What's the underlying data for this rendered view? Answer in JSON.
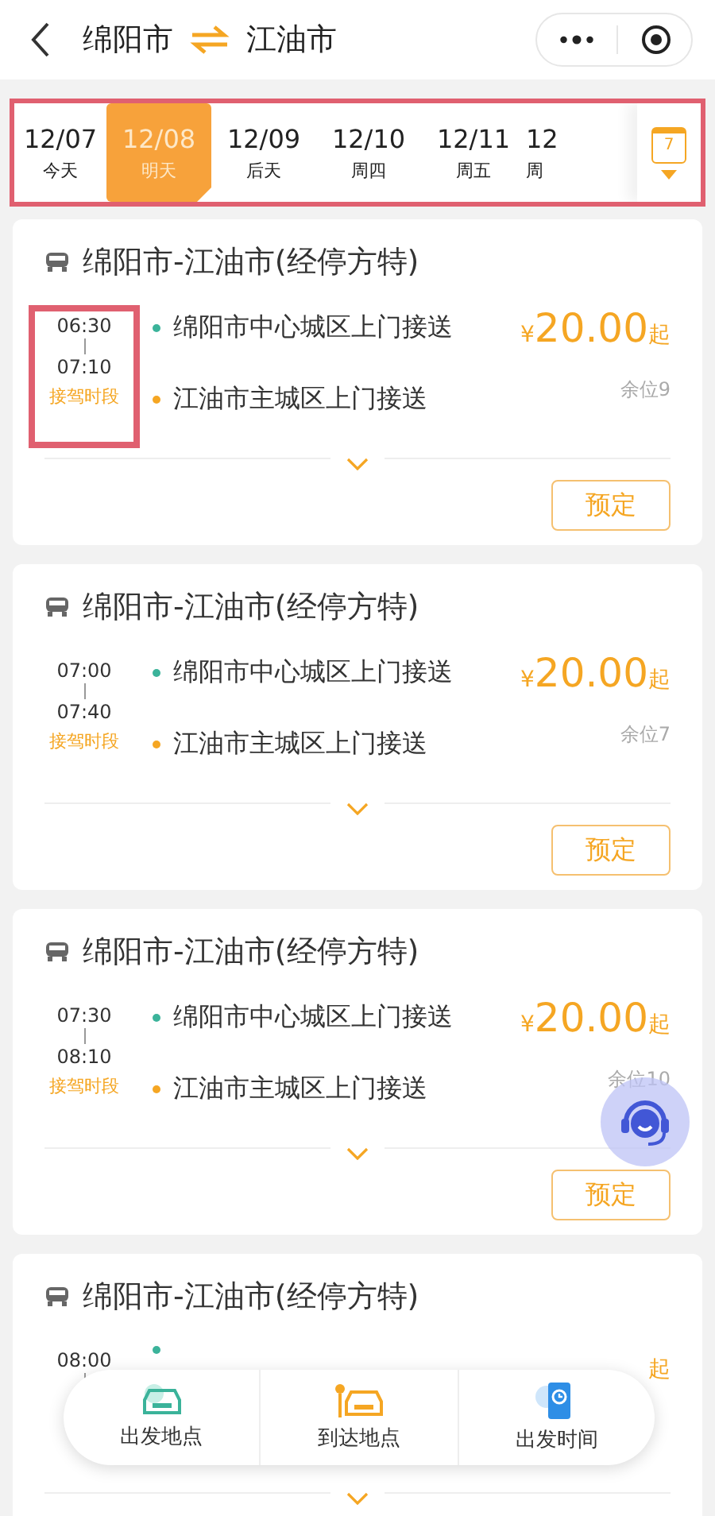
{
  "header": {
    "from": "绵阳市",
    "to": "江油市"
  },
  "date_strip": {
    "highlighted": true,
    "calendar_day": "7",
    "dates": [
      {
        "date": "12/07",
        "label": "今天",
        "selected": false
      },
      {
        "date": "12/08",
        "label": "明天",
        "selected": true
      },
      {
        "date": "12/09",
        "label": "后天",
        "selected": false
      },
      {
        "date": "12/10",
        "label": "周四",
        "selected": false
      },
      {
        "date": "12/11",
        "label": "周五",
        "selected": false
      },
      {
        "date": "12",
        "label": "周",
        "selected": false
      }
    ]
  },
  "trips": [
    {
      "title": "绵阳市-江油市(经停方特)",
      "time_start": "06:30",
      "time_end": "07:10",
      "time_label": "接驾时段",
      "highlighted": true,
      "from_stop": "绵阳市中心城区上门接送",
      "to_stop": "江油市主城区上门接送",
      "currency": "¥",
      "price": "20.00",
      "price_suffix": "起",
      "seats": "余位9",
      "button": "预定"
    },
    {
      "title": "绵阳市-江油市(经停方特)",
      "time_start": "07:00",
      "time_end": "07:40",
      "time_label": "接驾时段",
      "highlighted": false,
      "from_stop": "绵阳市中心城区上门接送",
      "to_stop": "江油市主城区上门接送",
      "currency": "¥",
      "price": "20.00",
      "price_suffix": "起",
      "seats": "余位7",
      "button": "预定"
    },
    {
      "title": "绵阳市-江油市(经停方特)",
      "time_start": "07:30",
      "time_end": "08:10",
      "time_label": "接驾时段",
      "highlighted": false,
      "from_stop": "绵阳市中心城区上门接送",
      "to_stop": "江油市主城区上门接送",
      "currency": "¥",
      "price": "20.00",
      "price_suffix": "起",
      "seats": "余位10",
      "button": "预定"
    },
    {
      "title": "绵阳市-江油市(经停方特)",
      "time_start": "08:00",
      "highlighted": false,
      "price_suffix": "起"
    }
  ],
  "bottom_bar": [
    {
      "label": "出发地点",
      "kind": "departure"
    },
    {
      "label": "到达地点",
      "kind": "arrival"
    },
    {
      "label": "出发时间",
      "kind": "time"
    }
  ]
}
